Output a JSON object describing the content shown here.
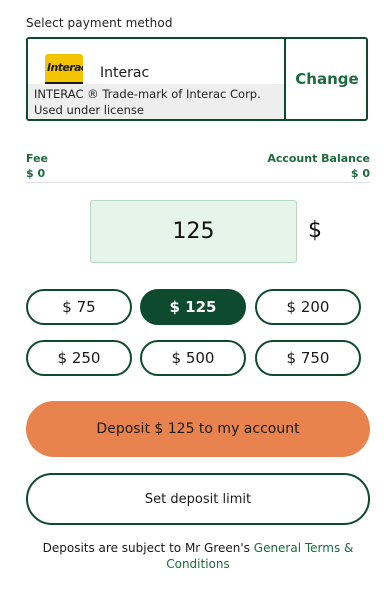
{
  "payment": {
    "section_label": "Select payment method",
    "method_name": "Interac",
    "logo_text": "Interac",
    "disclaimer_line1": "INTERAC ® Trade-mark of Interac Corp.",
    "disclaimer_line2": "Used under license",
    "change_label": "Change"
  },
  "summary": {
    "fee_label": "Fee",
    "fee_value": "$ 0",
    "balance_label": "Account Balance",
    "balance_value": "$ 0"
  },
  "amount": {
    "value": "125",
    "currency_sign": "$"
  },
  "presets": [
    {
      "label": "$ 75",
      "selected": false
    },
    {
      "label": "$ 125",
      "selected": true
    },
    {
      "label": "$ 200",
      "selected": false
    },
    {
      "label": "$ 250",
      "selected": false
    },
    {
      "label": "$ 500",
      "selected": false
    },
    {
      "label": "$ 750",
      "selected": false
    }
  ],
  "actions": {
    "deposit_label": "Deposit $ 125 to my account",
    "limit_label": "Set deposit limit"
  },
  "terms": {
    "prefix": "Deposits are subject to Mr Green's",
    "link": "General Terms & Conditions"
  },
  "colors": {
    "brand_green": "#0d4a2e",
    "link_green": "#1e6a3f",
    "deposit_orange": "#e8834d",
    "amount_bg": "#e6f4ea",
    "logo_yellow": "#f5c400"
  }
}
